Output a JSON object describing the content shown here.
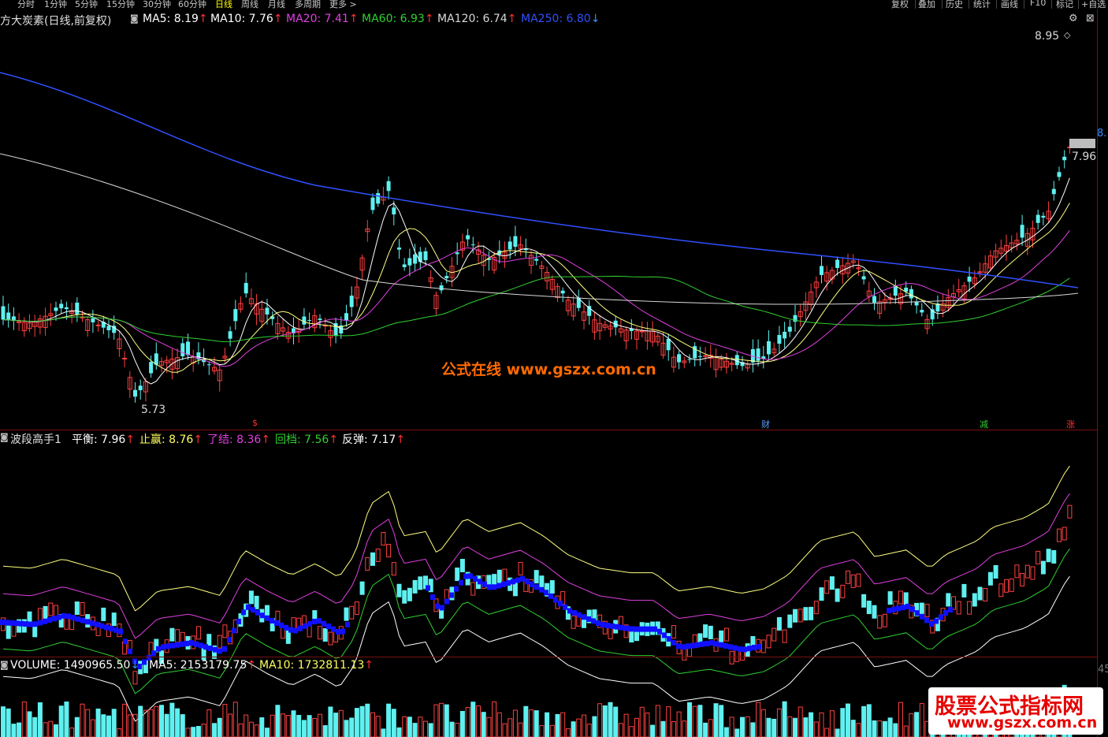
{
  "toolbar": {
    "periods": [
      "分时",
      "1分钟",
      "5分钟",
      "15分钟",
      "30分钟",
      "60分钟",
      "日线",
      "周线",
      "月线",
      "多周期",
      "更多 >"
    ],
    "active_period": "日线",
    "right_buttons": [
      "复权",
      "叠加",
      "历史",
      "统计",
      "画线",
      "F10",
      "标记",
      "+自选"
    ]
  },
  "main": {
    "title": "方大炭素(日线,前复权)",
    "ma": [
      {
        "label": "MA5: 8.19",
        "arrow": "↑",
        "color": "#ffffff"
      },
      {
        "label": "MA10: 7.76",
        "arrow": "↑",
        "color": "#ffffff"
      },
      {
        "label": "MA20: 7.41",
        "arrow": "↑",
        "color": "#e040e0"
      },
      {
        "label": "MA60: 6.93",
        "arrow": "↑",
        "color": "#30d030"
      },
      {
        "label": "MA120: 6.74",
        "arrow": "↑",
        "color": "#d8d8d8"
      },
      {
        "label": "MA250: 6.80",
        "arrow": "↓",
        "color": "#3050ff"
      }
    ],
    "high_label": "8.95",
    "low_label": "5.73",
    "price_tag": "8.",
    "ref_value": "7.96",
    "markers": [
      {
        "text": "$",
        "color": "#ff3030"
      },
      {
        "text": "财",
        "color": "#5aa0ff"
      },
      {
        "text": "减",
        "color": "#30d030"
      },
      {
        "text": "涨",
        "color": "#ff3030"
      }
    ]
  },
  "wave": {
    "title": "波段高手1",
    "items": [
      {
        "label": "平衡: 7.96",
        "arrow": "↑",
        "color": "#ffffff"
      },
      {
        "label": "止赢: 8.76",
        "arrow": "↑",
        "color": "#ffff60"
      },
      {
        "label": "了结: 8.36",
        "arrow": "↑",
        "color": "#e040e0"
      },
      {
        "label": "回档: 7.56",
        "arrow": "↑",
        "color": "#30d030"
      },
      {
        "label": "反弹: 7.17",
        "arrow": "↑",
        "color": "#ffffff"
      }
    ]
  },
  "volume": {
    "items": [
      {
        "label": "VOLUME: 1490965.50",
        "arrow": "↓",
        "color": "#ffffff"
      },
      {
        "label": "MA5: 2153179.75",
        "arrow": "↑",
        "color": "#ffffff"
      },
      {
        "label": "MA10: 1732811.13",
        "arrow": "↑",
        "color": "#ffff60"
      }
    ],
    "axis_label": "45"
  },
  "watermarks": {
    "center": "公式在线  www.gszx.com.cn",
    "corner_line1": "股票公式指标网",
    "corner_line2": "www.gszx.com.cn"
  }
}
